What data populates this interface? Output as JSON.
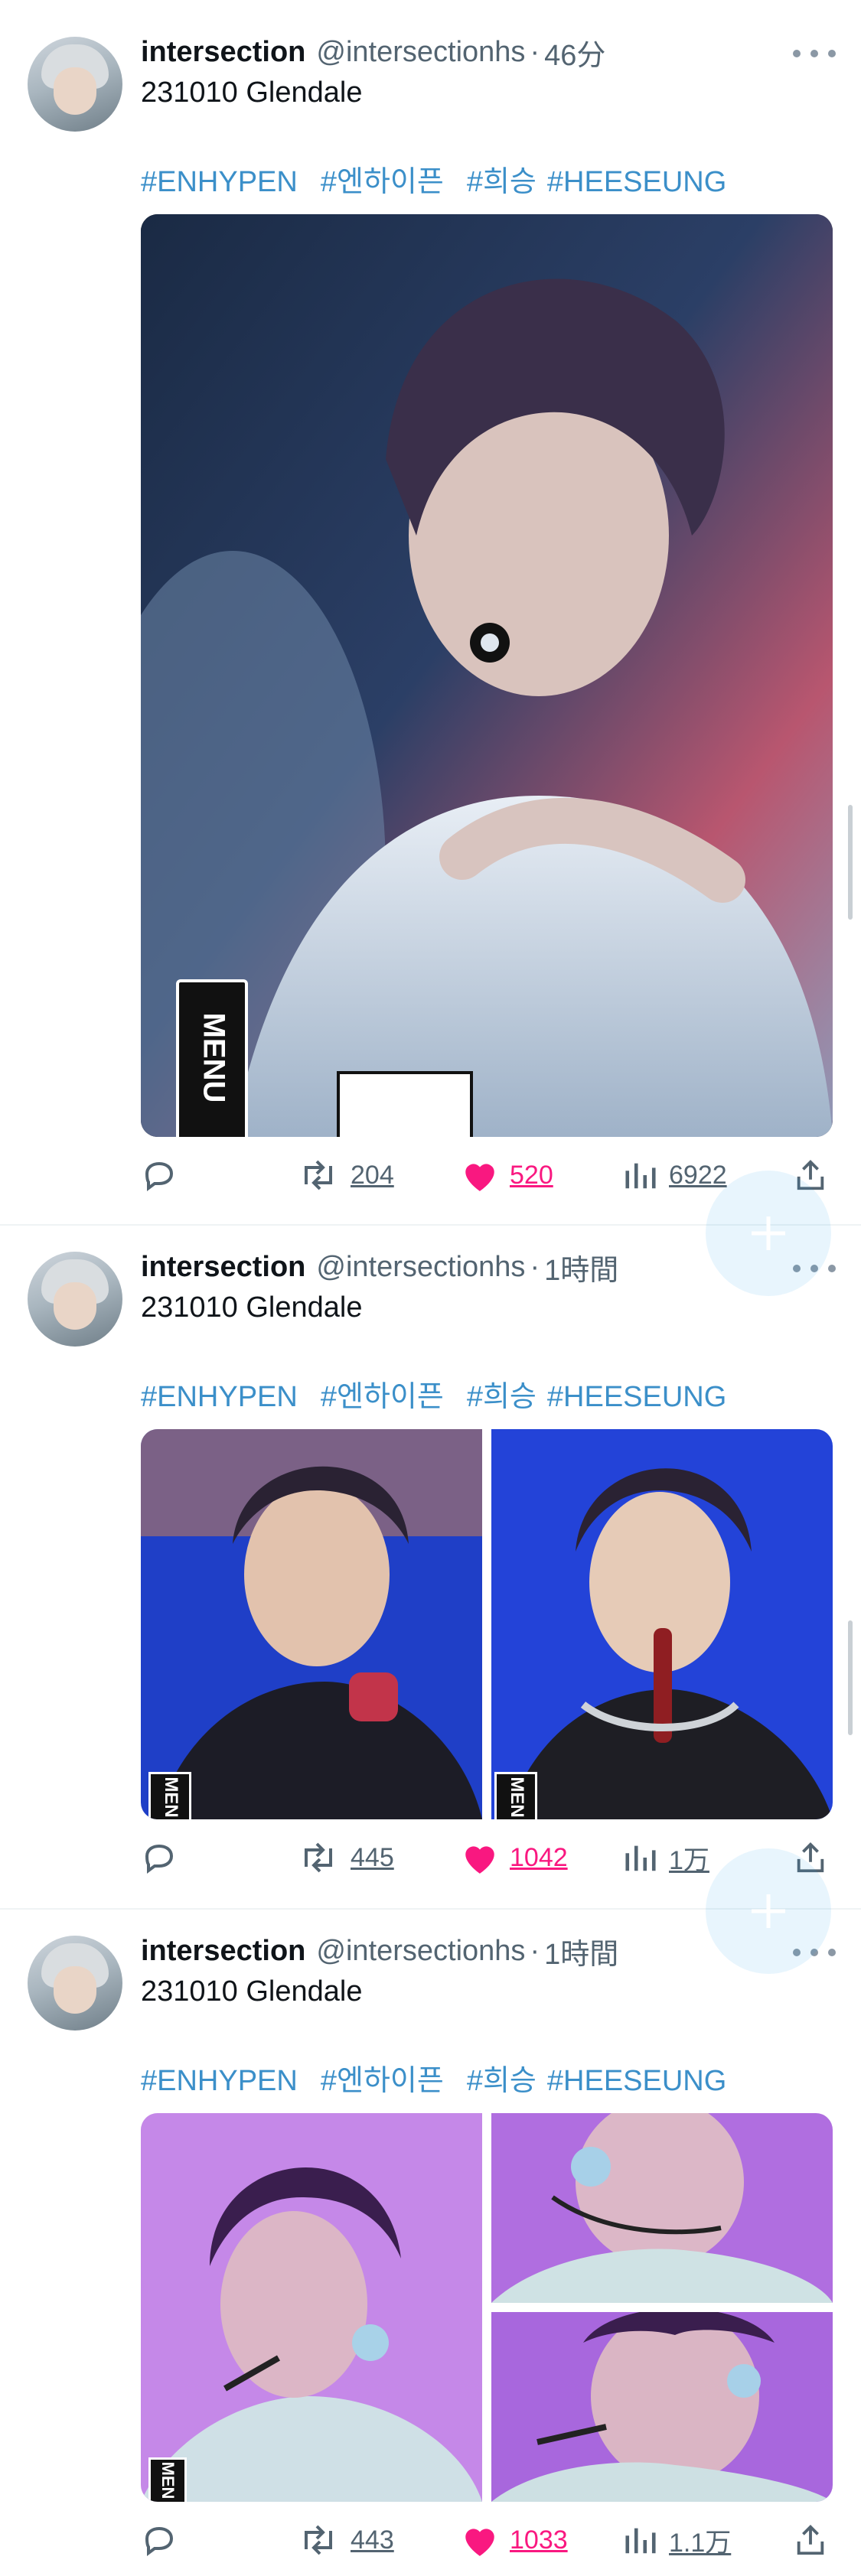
{
  "tweets": [
    {
      "name": "intersection",
      "handle": "@intersectionhs",
      "separator": "·",
      "time": "46分",
      "text": "231010 Glendale",
      "hashtags": [
        "#ENHYPEN",
        "#엔하이픈",
        "#희승",
        "#HEESEUNG"
      ],
      "retweets": "204",
      "likes": "520",
      "views": "6922",
      "images": [
        "photo-1"
      ]
    },
    {
      "name": "intersection",
      "handle": "@intersectionhs",
      "separator": "·",
      "time": "1時間",
      "text": "231010 Glendale",
      "hashtags": [
        "#ENHYPEN",
        "#엔하이픈",
        "#희승",
        "#HEESEUNG"
      ],
      "retweets": "445",
      "likes": "1042",
      "views": "1万",
      "images": [
        "photo-1",
        "photo-2"
      ]
    },
    {
      "name": "intersection",
      "handle": "@intersectionhs",
      "separator": "·",
      "time": "1時間",
      "text": "231010 Glendale",
      "hashtags": [
        "#ENHYPEN",
        "#엔하이픈",
        "#희승",
        "#HEESEUNG"
      ],
      "retweets": "443",
      "likes": "1033",
      "views": "1.1万",
      "images": [
        "photo-1",
        "photo-2",
        "photo-3"
      ]
    }
  ],
  "overlay_text": {
    "menu": "MENU",
    "menu_short": "MEN"
  },
  "icons": {
    "reply": "reply-icon",
    "retweet": "retweet-icon",
    "like": "heart-icon",
    "views": "views-icon",
    "share": "share-icon",
    "more": "more-icon",
    "compose": "compose-plus-icon"
  },
  "colors": {
    "hashtag": "#3b8fc9",
    "like": "#f91880",
    "secondary": "#536471"
  }
}
